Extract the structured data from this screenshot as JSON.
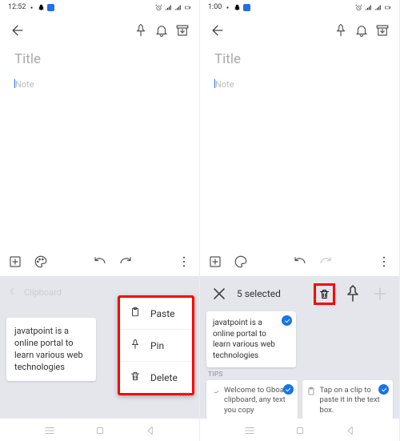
{
  "left": {
    "status": {
      "time": "12:52"
    },
    "title_placeholder": "Title",
    "note_placeholder": "Note",
    "clip_card": "javatpoint is a online portal to learn various web technologies",
    "menu": {
      "paste": "Paste",
      "pin": "Pin",
      "delete": "Delete"
    }
  },
  "right": {
    "status": {
      "time": "1:00"
    },
    "title_placeholder": "Title",
    "note_placeholder": "Note",
    "selection": {
      "count_label": "5 selected"
    },
    "clip_card": "javatpoint is a online portal to learn various web technologies",
    "tips_label": "TIPS",
    "tip1": "Welcome to Gboard clipboard, any text you copy",
    "tip2": "Tap on a clip to paste it in the text box."
  }
}
